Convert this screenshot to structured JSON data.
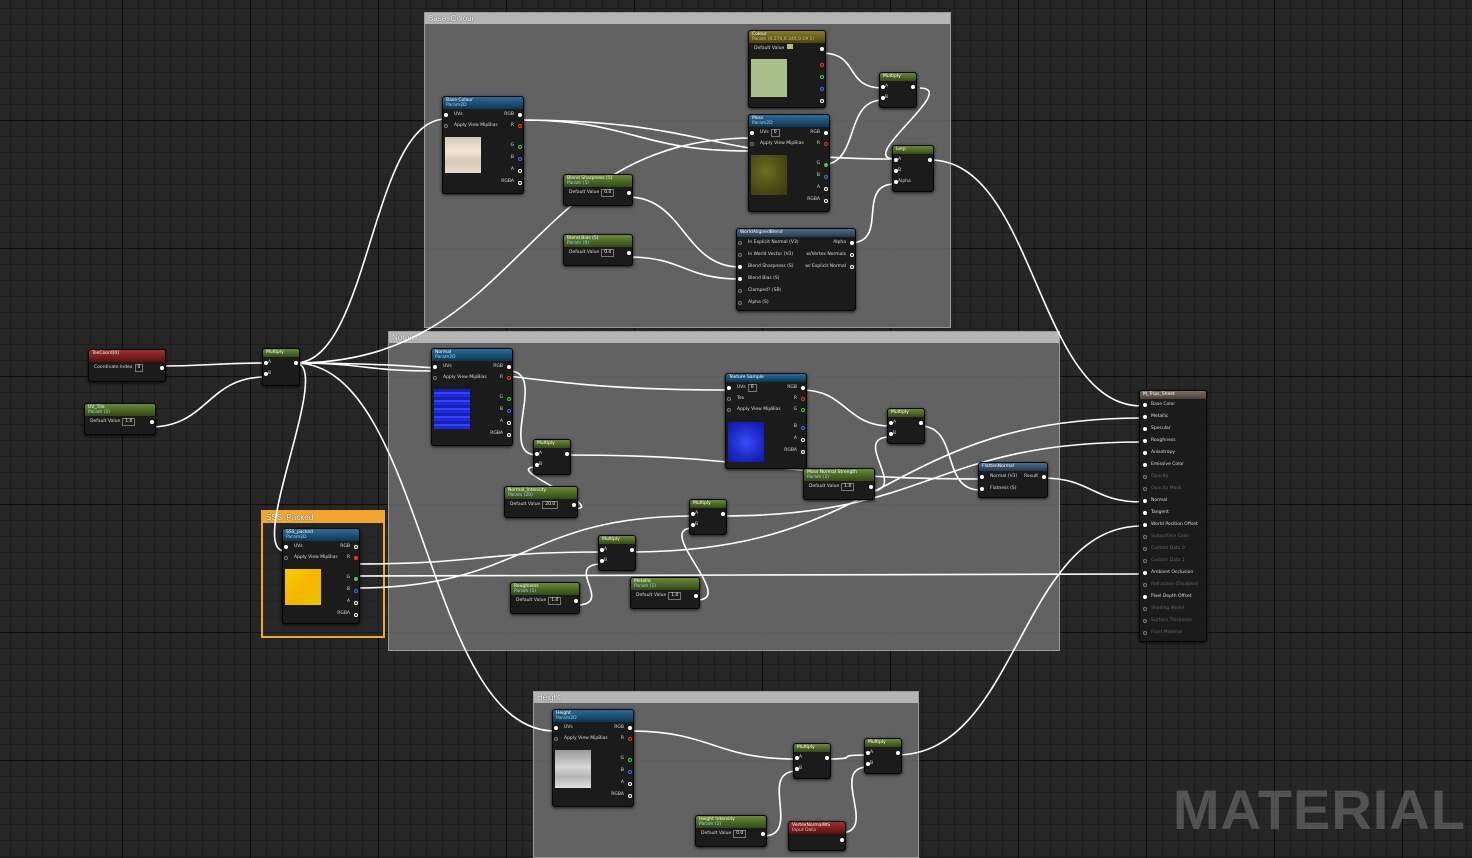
{
  "groups": {
    "base": "Base_Colour",
    "normal": "Normal",
    "sss": "SSS_Packed",
    "height": "Height"
  },
  "common": {
    "uvs": "UVs",
    "apply_mip": "Apply View MipBias",
    "default_value": "Default Value",
    "rgb": "RGB",
    "r": "R",
    "g": "G",
    "b": "B",
    "a": "A",
    "rgba": "RGBA",
    "pin_a": "A",
    "pin_b": "B",
    "alpha": "Alpha",
    "tex": "Tex",
    "multiply": "Multiply"
  },
  "nodes": {
    "base_colour": {
      "title": "Base Colour",
      "subtitle": "Param2D"
    },
    "colour": {
      "title": "Colour",
      "subtitle": "Param (0.270,0.344,0.19 1)"
    },
    "moss": {
      "title": "Moss",
      "subtitle": "Param2D",
      "uvs_value": "0"
    },
    "lerp": {
      "title": "Lerp"
    },
    "blend_sharpness": {
      "title": "Blend Sharpness (5)",
      "subtitle": "Param (5)",
      "value": "0.0"
    },
    "blend_bias": {
      "title": "Blend Bias (5)",
      "subtitle": "Param (0)",
      "value": "0.0"
    },
    "world_aligned": {
      "title": "WorldAlignedBlend",
      "inputs": [
        "In Explicit Normal (V3)",
        "In World Vector (V3)",
        "Blend Sharpness (S)",
        "Blend Bias (S)",
        "Clamped? (SB)",
        "Alpha (S)"
      ],
      "outputs": [
        "Alpha",
        "w/Vertex Normals",
        "w/ Explicit Normal"
      ]
    },
    "texcoord": {
      "title": "TexCoord[0]",
      "label": "Coordinate Index",
      "value": "0"
    },
    "uv_tile": {
      "title": "UV_Tile",
      "subtitle": "Param (1)",
      "value": "1.0"
    },
    "normal": {
      "title": "Normal",
      "subtitle": "Param2D"
    },
    "texture_sample": {
      "title": "Texture Sample",
      "uvs_value": "0"
    },
    "normal_intensity": {
      "title": "Normal_Intensity",
      "subtitle": "Param (20)",
      "value": "20.0"
    },
    "moss_normal_strength": {
      "title": "Moss Normal Strength",
      "subtitle": "Param (1)",
      "value": "1.0"
    },
    "flatten_normal": {
      "title": "FlattenNormal",
      "inputs": [
        "Normal (V3)",
        "Flatness (S)"
      ],
      "output": "Result"
    },
    "sss_packed": {
      "title": "SSS_packed",
      "subtitle": "Param2D"
    },
    "roughness": {
      "title": "Roughness",
      "subtitle": "Param (1)",
      "value": "1.0"
    },
    "metallic": {
      "title": "Metallic",
      "subtitle": "Param (1)",
      "value": "1.0"
    },
    "height": {
      "title": "Height",
      "subtitle": "Param2D"
    },
    "height_intensity": {
      "title": "Height Intensity",
      "subtitle": "Param (2)",
      "value": "0.0"
    },
    "vertex_normal": {
      "title": "VertexNormalWS",
      "subtitle": "Input Data"
    },
    "material_output": {
      "title": "M_Trips_Sheet",
      "pins": [
        {
          "label": "Base Color",
          "active": true
        },
        {
          "label": "Metallic",
          "active": true
        },
        {
          "label": "Specular",
          "active": true
        },
        {
          "label": "Roughness",
          "active": true
        },
        {
          "label": "Anisotropy",
          "active": true
        },
        {
          "label": "Emissive Color",
          "active": true
        },
        {
          "label": "Opacity",
          "active": false
        },
        {
          "label": "Opacity Mask",
          "active": false
        },
        {
          "label": "Normal",
          "active": true
        },
        {
          "label": "Tangent",
          "active": true
        },
        {
          "label": "World Position Offset",
          "active": true
        },
        {
          "label": "Subsurface Color",
          "active": false
        },
        {
          "label": "Custom Data 0",
          "active": false
        },
        {
          "label": "Custom Data 1",
          "active": false
        },
        {
          "label": "Ambient Occlusion",
          "active": true
        },
        {
          "label": "Refraction (Disabled)",
          "active": false
        },
        {
          "label": "Pixel Depth Offset",
          "active": true
        },
        {
          "label": "Shading Model",
          "active": false
        },
        {
          "label": "Surface Thickness",
          "active": false
        },
        {
          "label": "Front Material",
          "active": false
        }
      ]
    }
  },
  "watermark": "MATERIAL",
  "colors": {
    "sss_accent": "#f0a630",
    "wire": "#ffffff",
    "moss_swatch": "#a9bf8c"
  }
}
